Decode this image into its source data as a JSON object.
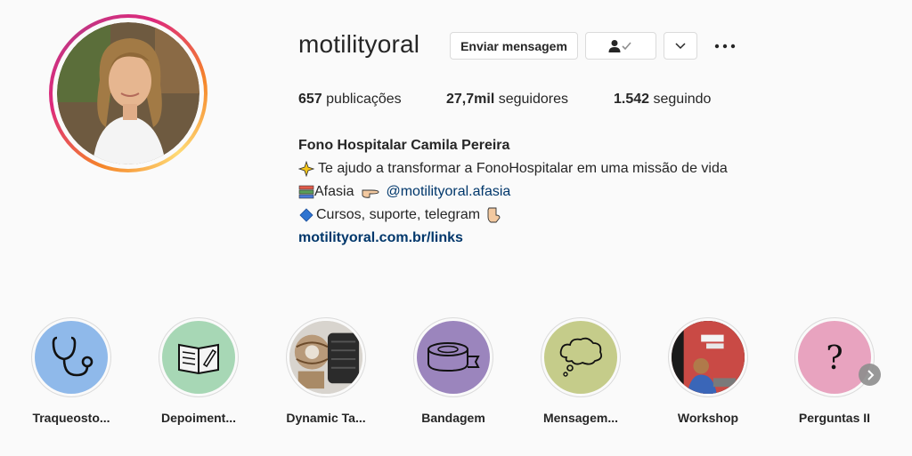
{
  "profile": {
    "username": "motilityoral",
    "message_button": "Enviar mensagem",
    "follow_icon": "person-check-icon",
    "chevron_icon": "chevron-down-icon",
    "more_icon": "more-horizontal-icon"
  },
  "stats": {
    "posts_value": "657",
    "posts_label": "publicações",
    "followers_value": "27,7mil",
    "followers_label": "seguidores",
    "following_value": "1.542",
    "following_label": "seguindo"
  },
  "bio": {
    "name": "Fono Hospitalar Camila Pereira",
    "line1": "Te ajudo a transformar a FonoHospitalar em uma missão de vida",
    "line2_text": "Afasia",
    "line2_mention": "@motilityoral.afasia",
    "line3": "Cursos, suporte, telegram",
    "link": "motilityoral.com.br/links"
  },
  "highlights": [
    {
      "label": "Traqueosto...",
      "icon": "stethoscope-icon",
      "color": "#8fb9ea"
    },
    {
      "label": "Depoiment...",
      "icon": "open-book-icon",
      "color": "#a7d7b5"
    },
    {
      "label": "Dynamic Ta...",
      "icon": "tape-photo",
      "color": "#b89a7a"
    },
    {
      "label": "Bandagem",
      "icon": "tape-roll-icon",
      "color": "#9b85bd"
    },
    {
      "label": "Mensagem...",
      "icon": "thought-bubble-icon",
      "color": "#c5cc8a"
    },
    {
      "label": "Workshop",
      "icon": "workshop-photo",
      "color": "#c94a45"
    },
    {
      "label": "Perguntas II",
      "icon": "question-mark-icon",
      "color": "#e8a3bf"
    }
  ],
  "colors": {
    "text": "#262626",
    "link": "#00376b",
    "border": "#dbdbdb",
    "background": "#fafafa"
  }
}
